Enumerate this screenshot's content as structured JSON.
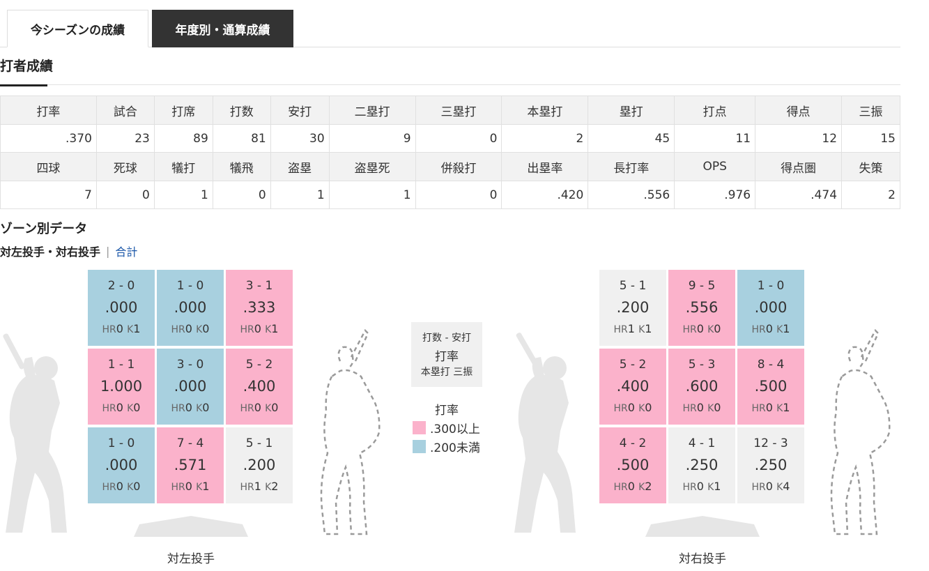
{
  "tabs": {
    "current": "今シーズンの成績",
    "other": "年度別・通算成績"
  },
  "section_title": "打者成績",
  "stats": {
    "head1": [
      "打率",
      "試合",
      "打席",
      "打数",
      "安打",
      "二塁打",
      "三塁打",
      "本塁打",
      "塁打",
      "打点",
      "得点",
      "三振"
    ],
    "val1": [
      ".370",
      "23",
      "89",
      "81",
      "30",
      "9",
      "0",
      "2",
      "45",
      "11",
      "12",
      "15"
    ],
    "head2": [
      "四球",
      "死球",
      "犠打",
      "犠飛",
      "盗塁",
      "盗塁死",
      "併殺打",
      "出塁率",
      "長打率",
      "OPS",
      "得点圏",
      "失策"
    ],
    "val2": [
      "7",
      "0",
      "1",
      "0",
      "1",
      "1",
      "0",
      ".420",
      ".556",
      ".976",
      ".474",
      "2"
    ]
  },
  "zone": {
    "title": "ゾーン別データ",
    "current_view": "対左投手・対右投手",
    "separator": "|",
    "total_link": "合計",
    "hr_label": "HR",
    "k_label": "K",
    "left": {
      "caption": "対左投手",
      "cells": [
        {
          "ab": "2 - 0",
          "avg": ".000",
          "hr": "0",
          "k": "1",
          "color": "blue"
        },
        {
          "ab": "1 - 0",
          "avg": ".000",
          "hr": "0",
          "k": "0",
          "color": "blue"
        },
        {
          "ab": "3 - 1",
          "avg": ".333",
          "hr": "0",
          "k": "1",
          "color": "pink"
        },
        {
          "ab": "1 - 1",
          "avg": "1.000",
          "hr": "0",
          "k": "0",
          "color": "pink"
        },
        {
          "ab": "3 - 0",
          "avg": ".000",
          "hr": "0",
          "k": "0",
          "color": "blue"
        },
        {
          "ab": "5 - 2",
          "avg": ".400",
          "hr": "0",
          "k": "0",
          "color": "pink"
        },
        {
          "ab": "1 - 0",
          "avg": ".000",
          "hr": "0",
          "k": "0",
          "color": "blue"
        },
        {
          "ab": "7 - 4",
          "avg": ".571",
          "hr": "0",
          "k": "1",
          "color": "pink"
        },
        {
          "ab": "5 - 1",
          "avg": ".200",
          "hr": "1",
          "k": "2",
          "color": "gray"
        }
      ]
    },
    "right": {
      "caption": "対右投手",
      "cells": [
        {
          "ab": "5 - 1",
          "avg": ".200",
          "hr": "1",
          "k": "1",
          "color": "gray"
        },
        {
          "ab": "9 - 5",
          "avg": ".556",
          "hr": "0",
          "k": "0",
          "color": "pink"
        },
        {
          "ab": "1 - 0",
          "avg": ".000",
          "hr": "0",
          "k": "1",
          "color": "blue"
        },
        {
          "ab": "5 - 2",
          "avg": ".400",
          "hr": "0",
          "k": "0",
          "color": "pink"
        },
        {
          "ab": "5 - 3",
          "avg": ".600",
          "hr": "0",
          "k": "0",
          "color": "pink"
        },
        {
          "ab": "8 - 4",
          "avg": ".500",
          "hr": "0",
          "k": "1",
          "color": "pink"
        },
        {
          "ab": "4 - 2",
          "avg": ".500",
          "hr": "0",
          "k": "2",
          "color": "pink"
        },
        {
          "ab": "4 - 1",
          "avg": ".250",
          "hr": "0",
          "k": "1",
          "color": "gray"
        },
        {
          "ab": "12 - 3",
          "avg": ".250",
          "hr": "0",
          "k": "4",
          "color": "gray"
        }
      ]
    },
    "legend": {
      "line1": "打数 - 安打",
      "line2": "打率",
      "line3": "本塁打 三振",
      "label": "打率",
      "high": ".300以上",
      "low": ".200未満"
    }
  },
  "colors": {
    "pink": "#fbb2cb",
    "blue": "#a8d0df",
    "gray": "#f0f0f0",
    "tab_dark": "#333333",
    "link": "#1a56a8"
  }
}
